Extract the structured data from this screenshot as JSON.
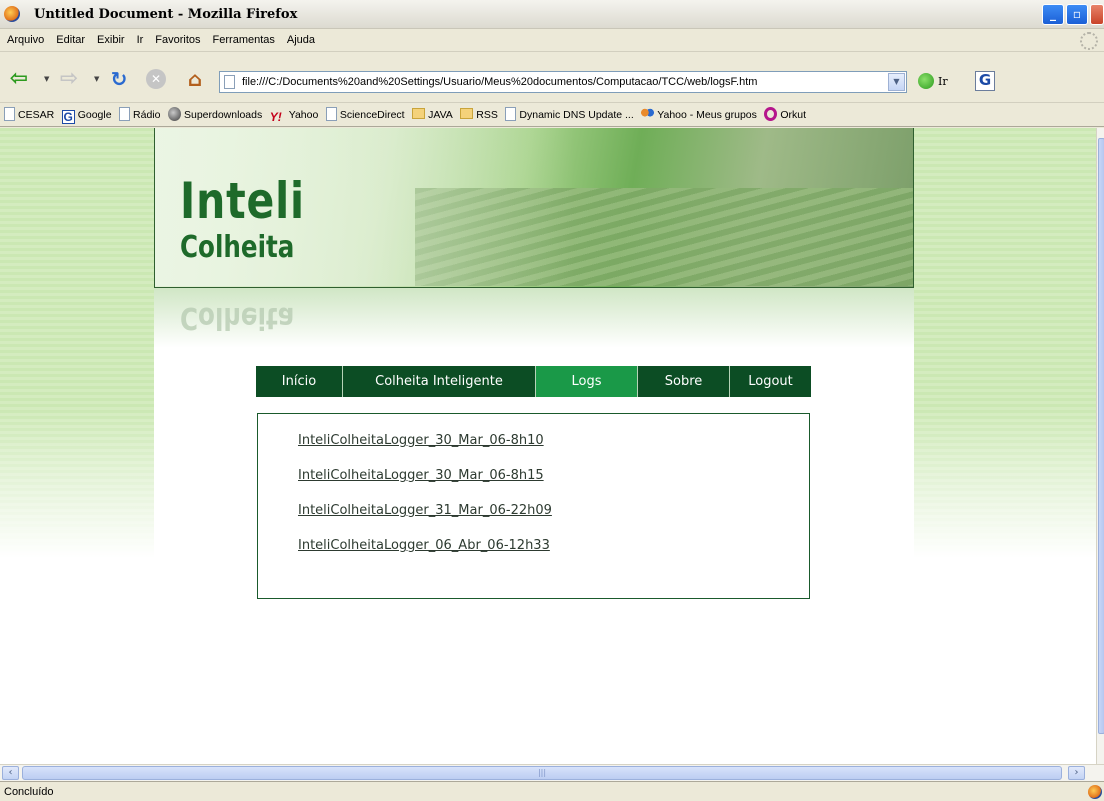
{
  "window": {
    "title": "Untitled Document - Mozilla Firefox",
    "buttons": {
      "minimize": "_",
      "maximize": "▫",
      "close": "✕"
    }
  },
  "menubar": {
    "items": [
      "Arquivo",
      "Editar",
      "Exibir",
      "Ir",
      "Favoritos",
      "Ferramentas",
      "Ajuda"
    ]
  },
  "navbar": {
    "url": "file:///C:/Documents%20and%20Settings/Usuario/Meus%20documentos/Computacao/TCC/web/logsF.htm",
    "go_label": "Ir",
    "search_engine": "G"
  },
  "bookmarks": [
    {
      "label": "CESAR",
      "icon": "page-icon"
    },
    {
      "label": "Google",
      "icon": "google-icon"
    },
    {
      "label": "Rádio",
      "icon": "page-icon"
    },
    {
      "label": "Superdownloads",
      "icon": "globe-icon"
    },
    {
      "label": "Yahoo",
      "icon": "yahoo-icon"
    },
    {
      "label": "ScienceDirect",
      "icon": "page-icon"
    },
    {
      "label": "JAVA",
      "icon": "folder-icon"
    },
    {
      "label": "RSS",
      "icon": "folder-icon"
    },
    {
      "label": "Dynamic DNS Update ...",
      "icon": "page-icon"
    },
    {
      "label": "Yahoo - Meus grupos",
      "icon": "group-icon"
    },
    {
      "label": "Orkut",
      "icon": "orkut-icon"
    }
  ],
  "page": {
    "logo": {
      "line1": "Inteli",
      "line2": "Colheita"
    },
    "nav": [
      {
        "label": "Início",
        "active": false
      },
      {
        "label": "Colheita Inteligente",
        "active": false
      },
      {
        "label": "Logs",
        "active": true
      },
      {
        "label": "Sobre",
        "active": false
      },
      {
        "label": "Logout",
        "active": false
      }
    ],
    "logs": [
      "InteliColheitaLogger_30_Mar_06-8h10",
      "InteliColheitaLogger_30_Mar_06-8h15",
      "InteliColheitaLogger_31_Mar_06-22h09",
      "InteliColheitaLogger_06_Abr_06-12h33"
    ]
  },
  "status": {
    "text": "Concluído"
  },
  "colors": {
    "nav_bg": "#0c4d24",
    "nav_active": "#1a9948",
    "brand_green": "#1e6a2a"
  }
}
